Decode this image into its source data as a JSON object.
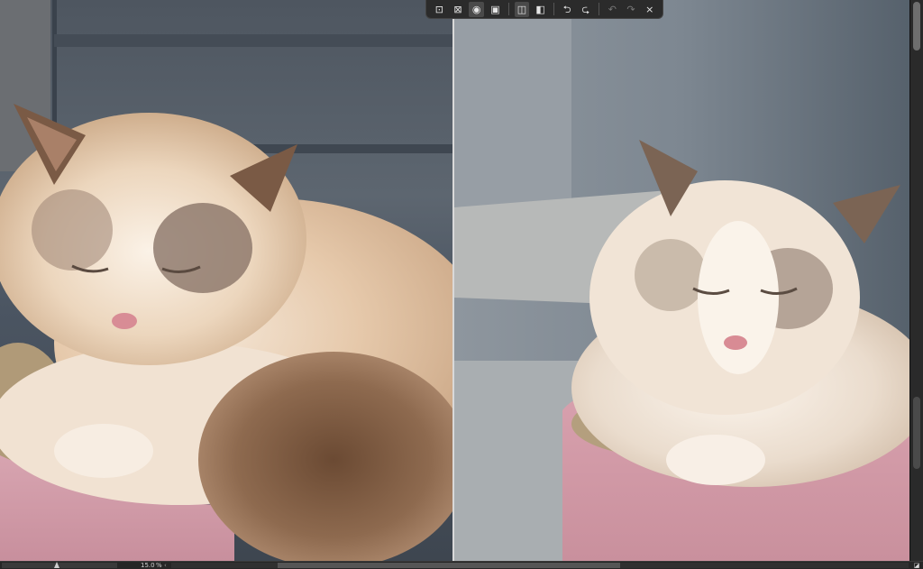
{
  "toolbar": {
    "buttons": [
      {
        "name": "zoom-fit-icon",
        "glyph": "⊡",
        "active": false
      },
      {
        "name": "zoom-fill-icon",
        "glyph": "⊠",
        "active": false
      },
      {
        "name": "zoom-actual-icon",
        "glyph": "◉",
        "active": true
      },
      {
        "name": "zoom-custom-icon",
        "glyph": "▣",
        "active": false
      },
      {
        "name": "compare-sidebyside-icon",
        "glyph": "◫",
        "active": true
      },
      {
        "name": "compare-split-icon",
        "glyph": "◧",
        "active": false
      },
      {
        "name": "swap-left-icon",
        "glyph": "⮌",
        "active": false
      },
      {
        "name": "swap-right-icon",
        "glyph": "⮎",
        "active": false
      },
      {
        "name": "undo-icon",
        "glyph": "↶",
        "dim": true
      },
      {
        "name": "redo-icon",
        "glyph": "↷",
        "dim": true
      },
      {
        "name": "close-icon",
        "glyph": "×",
        "dim": false
      }
    ]
  },
  "statusbar": {
    "zoom_value": "15.0",
    "zoom_unit": "%",
    "zoom_arrow": "‹",
    "corner_glyph": "◪"
  },
  "colors": {
    "ui_dark": "#1e1e1e",
    "toolbar_bg": "#2b2b2b",
    "divider": "#d9d9d9"
  }
}
